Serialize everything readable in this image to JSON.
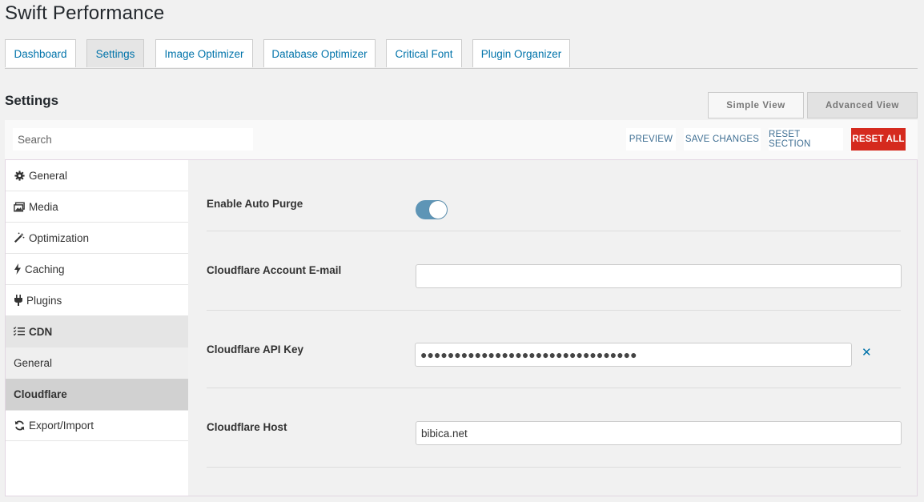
{
  "app_title": "Swift Performance",
  "tabs": [
    {
      "label": "Dashboard"
    },
    {
      "label": "Settings"
    },
    {
      "label": "Image Optimizer"
    },
    {
      "label": "Database Optimizer"
    },
    {
      "label": "Critical Font"
    },
    {
      "label": "Plugin Organizer"
    }
  ],
  "settings_heading": "Settings",
  "views": {
    "simple": "Simple View",
    "advanced": "Advanced View"
  },
  "toolbar": {
    "search_placeholder": "Search",
    "preview": "PREVIEW",
    "save": "SAVE CHANGES",
    "reset_section": "RESET SECTION",
    "reset_all": "RESET ALL"
  },
  "sidebar": {
    "items": [
      {
        "label": "General",
        "icon": "gear-icon"
      },
      {
        "label": "Media",
        "icon": "images-icon"
      },
      {
        "label": "Optimization",
        "icon": "magic-wand-icon"
      },
      {
        "label": "Caching",
        "icon": "bolt-icon"
      },
      {
        "label": "Plugins",
        "icon": "plug-icon"
      },
      {
        "label": "CDN",
        "icon": "list-check-icon"
      }
    ],
    "sub_items": [
      {
        "label": "General"
      },
      {
        "label": "Cloudflare"
      }
    ],
    "export": {
      "label": "Export/Import",
      "icon": "refresh-icon"
    }
  },
  "fields": {
    "auto_purge": {
      "label": "Enable Auto Purge",
      "enabled": true
    },
    "email": {
      "label": "Cloudflare Account E-mail",
      "value": ""
    },
    "api_key": {
      "label": "Cloudflare API Key",
      "value": "●●●●●●●●●●●●●●●●●●●●●●●●●●●●●●●●"
    },
    "host": {
      "label": "Cloudflare Host",
      "value": "bibica.net"
    }
  },
  "colors": {
    "accent": "#0073aa",
    "danger": "#d52a1e",
    "toggle": "#5e95b6"
  }
}
